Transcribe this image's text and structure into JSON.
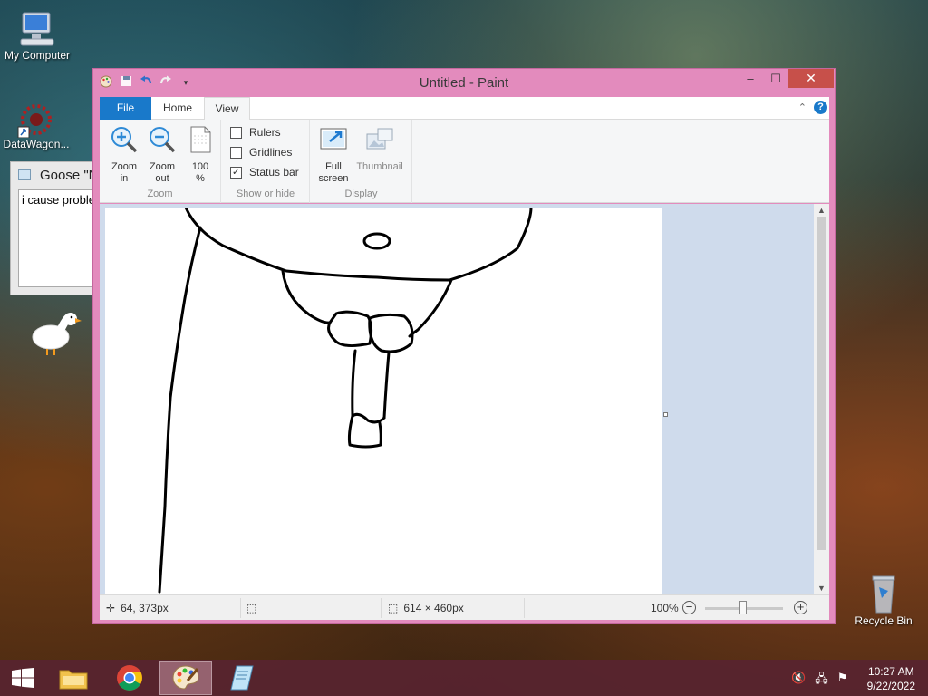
{
  "desktop": {
    "icons": [
      {
        "label": "My Computer",
        "icon": "computer-icon"
      },
      {
        "label": "DataWagon...",
        "icon": "datawagon-shortcut-icon"
      },
      {
        "label": "Recycle Bin",
        "icon": "recycle-bin-icon"
      }
    ]
  },
  "goose_window": {
    "title": "Goose \"N",
    "body": "i cause proble"
  },
  "paint": {
    "title": "Untitled - Paint",
    "window_buttons": {
      "minimize": "‒",
      "maximize": "☐",
      "close": "✕"
    },
    "tabs": [
      "File",
      "Home",
      "View"
    ],
    "active_tab": "View",
    "groups": {
      "zoom": {
        "label": "Zoom",
        "buttons": [
          {
            "label": "Zoom\nin"
          },
          {
            "label": "Zoom\nout"
          },
          {
            "label": "100\n%"
          }
        ]
      },
      "show_hide": {
        "label": "Show or hide",
        "options": [
          {
            "label": "Rulers",
            "checked": false
          },
          {
            "label": "Gridlines",
            "checked": false
          },
          {
            "label": "Status bar",
            "checked": true
          }
        ]
      },
      "display": {
        "label": "Display",
        "buttons": [
          {
            "label": "Full\nscreen",
            "enabled": true
          },
          {
            "label": "Thumbnail",
            "enabled": false
          }
        ]
      }
    },
    "statusbar": {
      "cursor_pos": "64, 373px",
      "image_size": "614 × 460px",
      "zoom": "100%",
      "zoom_level": 1.0
    },
    "help_glyph": "?"
  },
  "taskbar": {
    "apps": [
      "file-explorer",
      "chrome",
      "paint",
      "notepad"
    ],
    "active_app": "paint",
    "clock_time": "10:27 AM",
    "clock_date": "9/22/2022"
  },
  "colors": {
    "window_frame": "#e38bbd",
    "file_tab": "#1979ca",
    "close_button": "#c7504a",
    "taskbar": "#58242f"
  }
}
